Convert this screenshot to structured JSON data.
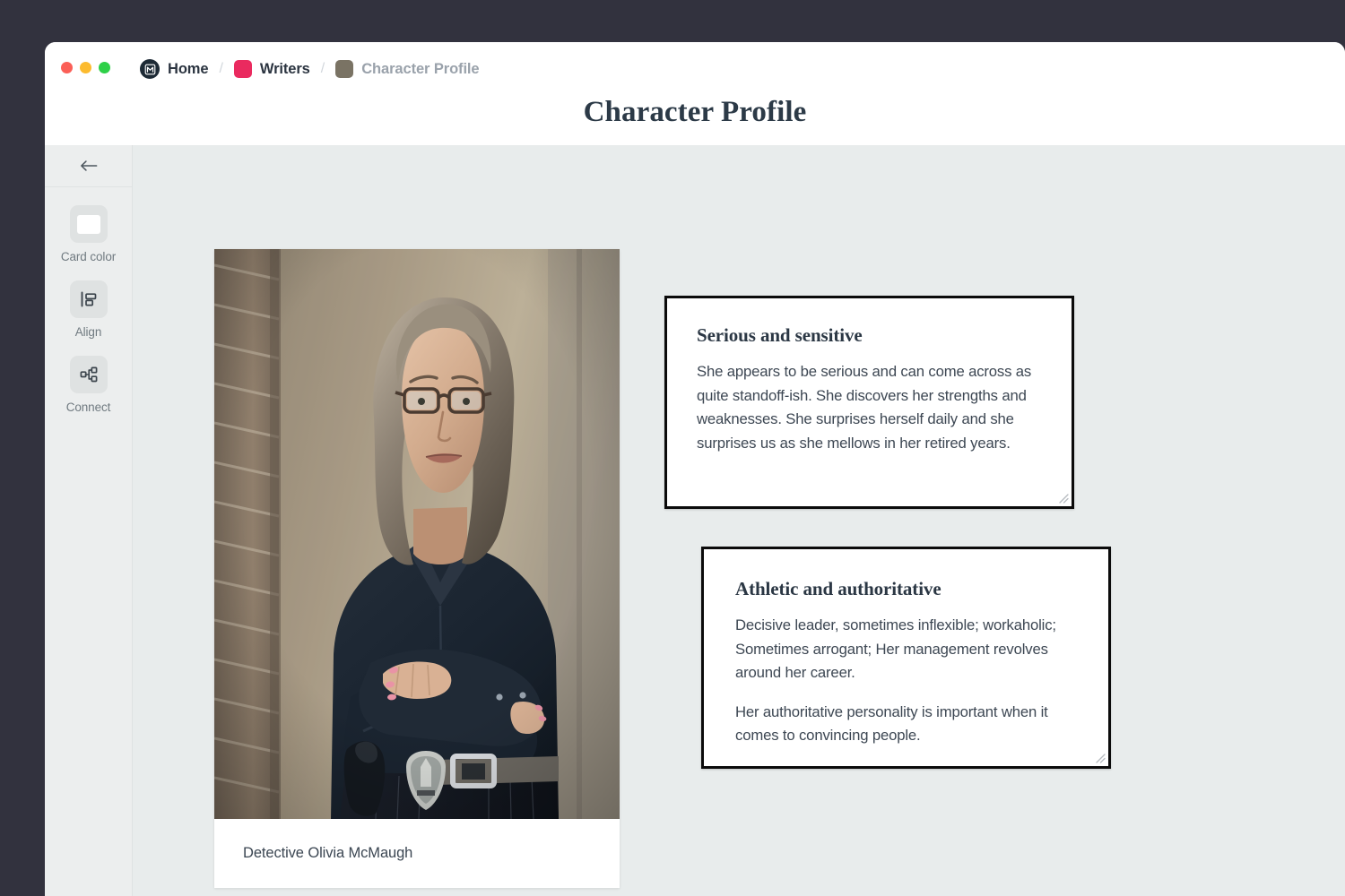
{
  "window": {
    "traffic_lights": [
      {
        "name": "close",
        "color": "#fb5f57"
      },
      {
        "name": "minimize",
        "color": "#fcbb2f"
      },
      {
        "name": "maximize",
        "color": "#2ed048"
      }
    ]
  },
  "breadcrumb": {
    "separator": "/",
    "items": [
      {
        "label": "Home",
        "icon": "home-logo-icon",
        "icon_color": "#1d2a35",
        "active": true
      },
      {
        "label": "Writers",
        "icon": "color-swatch",
        "icon_color": "#ea2a5f",
        "active": true
      },
      {
        "label": "Character Profile",
        "icon": "color-swatch",
        "icon_color": "#7a7364",
        "active": false
      }
    ]
  },
  "header": {
    "title": "Character Profile"
  },
  "sidebar": {
    "back_icon": "arrow-left-icon",
    "tools": [
      {
        "label": "Card color",
        "icon": "color-swatch-icon",
        "swatch": "#ffffff"
      },
      {
        "label": "Align",
        "icon": "align-left-icon"
      },
      {
        "label": "Connect",
        "icon": "connect-share-icon"
      }
    ]
  },
  "canvas": {
    "background": "#e8ecec",
    "photo_card": {
      "caption": "Detective Olivia McMaugh",
      "alt": "Portrait of a woman detective with glasses standing arms-crossed in front of a brick wall, wearing a dark navy shirt with a detective badge on her belt"
    },
    "text_cards": [
      {
        "id": "serious",
        "heading": "Serious and sensitive",
        "paragraphs": [
          "She appears to be serious and can come across as quite standoff-ish. She discovers her strengths and weaknesses. She surprises herself daily and she surprises us as she mellows in her retired years."
        ]
      },
      {
        "id": "athletic",
        "heading": "Athletic and authoritative",
        "paragraphs": [
          "Decisive leader, sometimes inflexible; workaholic; Sometimes arrogant; Her management revolves around her career.",
          "Her authoritative personality is important when it comes to convincing people."
        ]
      }
    ]
  },
  "colors": {
    "app_backdrop": "#32323e",
    "canvas_bg": "#e8ecec",
    "sidebar_bg": "#eceeee",
    "card_border": "#0b0b0b",
    "text_primary": "#2b3744",
    "text_body": "#3d4753",
    "text_muted": "#9aa2ab",
    "accent_pink": "#ea2a5f",
    "accent_olive": "#7a7364"
  }
}
